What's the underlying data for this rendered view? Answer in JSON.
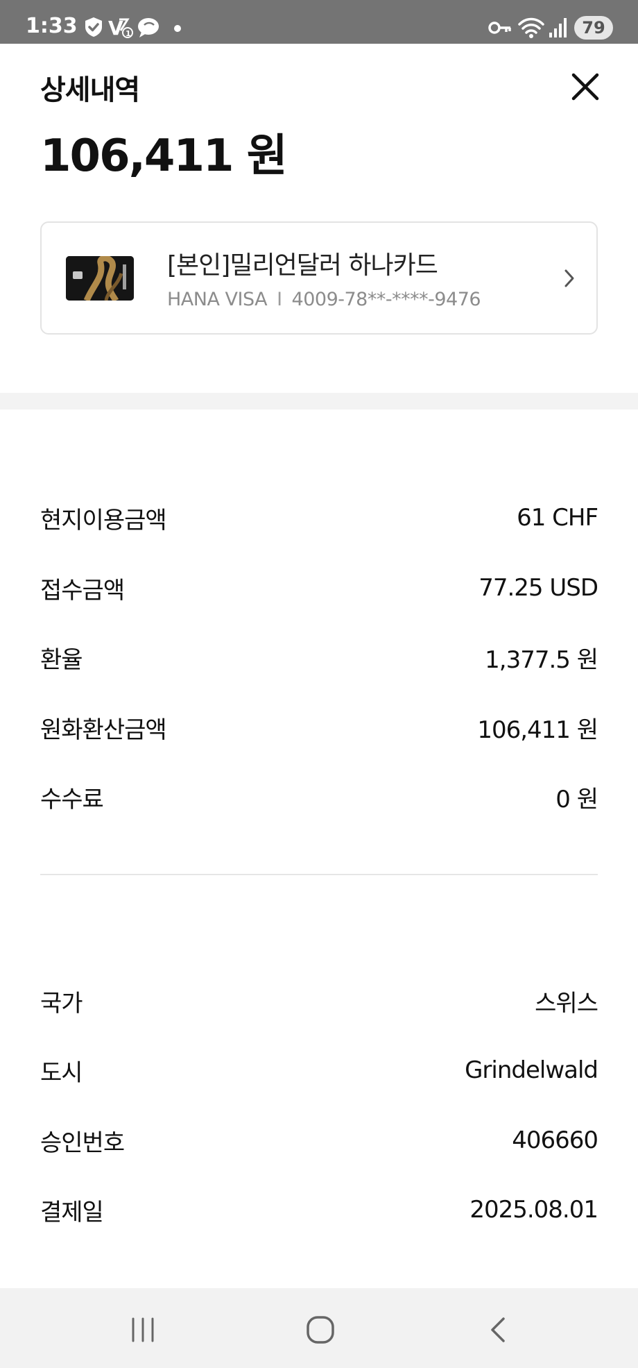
{
  "status_bar": {
    "time": "1:33",
    "battery": "79",
    "left_icons": [
      "shield-check-icon",
      "vpn-key-icon",
      "chat-icon",
      "dot-icon"
    ],
    "right_icons": [
      "key-icon",
      "wifi-icon",
      "signal-icon"
    ]
  },
  "header": {
    "title": "상세내역",
    "amount": "106,411 원",
    "close_icon": "close-icon"
  },
  "card": {
    "name": "[본인]밀리언달러 하나카드",
    "brand": "HANA VISA",
    "separator": "I",
    "number": "4009-78**-****-9476",
    "chevron_icon": "chevron-right-icon"
  },
  "details": {
    "local_amount_label": "현지이용금액",
    "local_amount_value": "61 CHF",
    "received_amount_label": "접수금액",
    "received_amount_value": "77.25 USD",
    "exchange_rate_label": "환율",
    "exchange_rate_value": "1,377.5 원",
    "krw_amount_label": "원화환산금액",
    "krw_amount_value": "106,411 원",
    "fee_label": "수수료",
    "fee_value": "0 원"
  },
  "merchant": {
    "country_label": "국가",
    "country_value": "스위스",
    "city_label": "도시",
    "city_value": "Grindelwald",
    "approval_label": "승인번호",
    "approval_value": "406660",
    "payment_date_label": "결제일",
    "payment_date_value": "2025.08.01"
  },
  "nav_bar": {
    "icons": [
      "recent-apps-icon",
      "home-icon",
      "back-icon"
    ]
  },
  "colors": {
    "status_bar_bg": "#747474",
    "text_primary": "#111111",
    "text_secondary": "#8c8c8c",
    "border": "#e3e3e3",
    "section_gap": "#f3f3f3",
    "nav_bar_bg": "#f2f2f2"
  }
}
